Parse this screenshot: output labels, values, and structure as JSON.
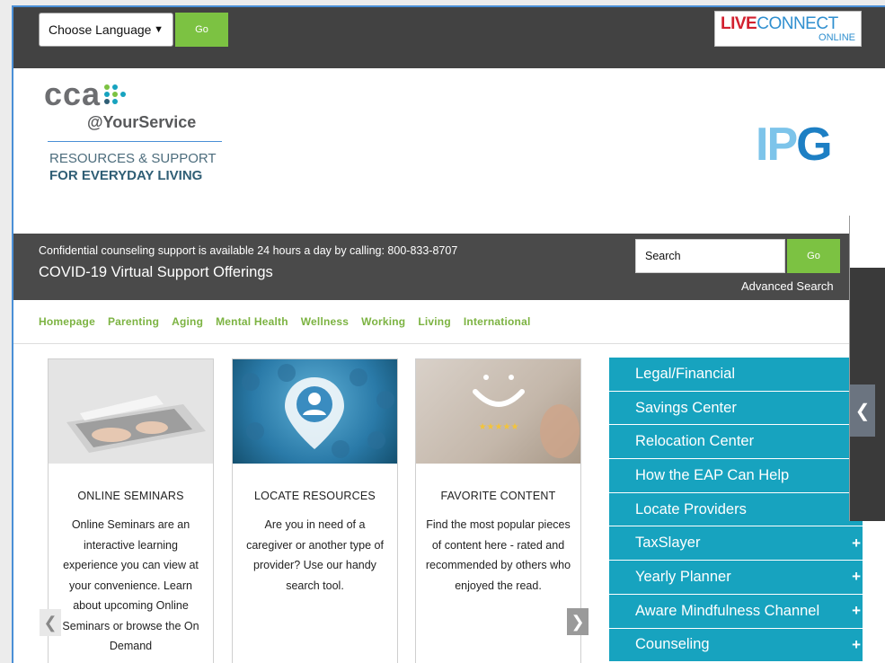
{
  "topbar": {
    "language_select_value": "Choose Language",
    "language_go_label": "Go",
    "liveconnect": {
      "main_live": "LIVE",
      "main_connect": "CONNECT",
      "sub": "ONLINE"
    }
  },
  "logo": {
    "cca": "cca",
    "your_service": "@YourService",
    "tagline_line1": "RESOURCES & SUPPORT",
    "tagline_line2": "FOR EVERYDAY LIVING",
    "ipg_i": "I",
    "ipg_p": "P",
    "ipg_g": "G"
  },
  "support": {
    "confidential_text": "Confidential counseling support is available 24 hours a day by calling: 800-833-8707",
    "covid_link": "COVID-19 Virtual Support Offerings",
    "search_value": "Search",
    "search_go_label": "Go",
    "advanced_search": "Advanced Search"
  },
  "nav": [
    "Homepage",
    "Parenting",
    "Aging",
    "Mental Health",
    "Wellness",
    "Working",
    "Living",
    "International"
  ],
  "cards": [
    {
      "title": "ONLINE SEMINARS",
      "body": "Online Seminars are an interactive learning experience you can view at your convenience. Learn about upcoming Online Seminars or browse the On Demand"
    },
    {
      "title": "LOCATE RESOURCES",
      "body": "Are you in need of a caregiver or another type of provider? Use our handy search tool."
    },
    {
      "title": "FAVORITE CONTENT",
      "body": "Find the most popular pieces of content here - rated and recommended by others who enjoyed the read."
    }
  ],
  "menu": [
    "Legal/Financial",
    "Savings Center",
    "Relocation Center",
    "How the EAP Can Help",
    "Locate Providers",
    "TaxSlayer",
    "Yearly Planner",
    "Aware Mindfulness Channel",
    "Counseling"
  ],
  "menu_expand_glyph": "+",
  "colors": {
    "topbar": "#424242",
    "accent_green": "#7cc242",
    "menu_teal": "#17a3bf",
    "nav_green": "#7cb342"
  }
}
